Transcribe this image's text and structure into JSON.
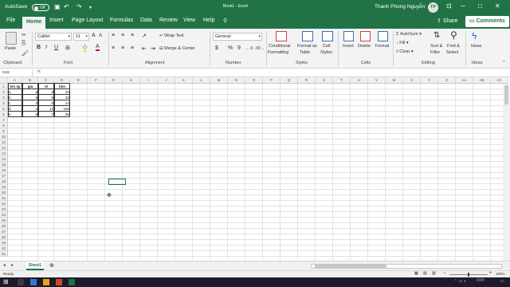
{
  "titlebar": {
    "autosave_label": "AutoSave",
    "autosave_state": "Off",
    "doc_title": "Book1 - Excel",
    "user_name": "Thanh Phong Nguyễn",
    "user_initials": "TP"
  },
  "tabs": [
    "File",
    "Home",
    "Insert",
    "Page Layout",
    "Formulas",
    "Data",
    "Review",
    "View",
    "Help"
  ],
  "active_tab": "Home",
  "share_label": "Share",
  "comments_label": "Comments",
  "ribbon": {
    "clipboard": {
      "label": "Clipboard",
      "paste": "Paste"
    },
    "font": {
      "label": "Font",
      "name": "Calibri",
      "size": "11",
      "bold": "B",
      "italic": "I",
      "underline": "U"
    },
    "alignment": {
      "label": "Alignment",
      "wrap_text": "Wrap Text",
      "merge_center": "Merge & Center"
    },
    "number": {
      "label": "Number",
      "format": "General",
      "dollar": "$",
      "percent": "%",
      "comma": "9"
    },
    "styles": {
      "label": "Styles",
      "conditional": [
        "Conditional",
        "Formatting"
      ],
      "format_table": [
        "Format as",
        "Table"
      ],
      "cell_styles": [
        "Cell",
        "Styles"
      ]
    },
    "cells": {
      "label": "Cells",
      "insert": "Insert",
      "delete": "Delete",
      "format": "Format"
    },
    "editing": {
      "label": "Editing",
      "autosum": "AutoSum",
      "fill": "Fill",
      "clear": "Clear",
      "sort_filter": [
        "Sort &",
        "Filter"
      ],
      "find_select": [
        "Find &",
        "Select"
      ]
    },
    "ideas": {
      "label": "Ideas",
      "ideas": "Ideas"
    }
  },
  "formula_bar": {
    "name_box": "G19",
    "fx": "fx",
    "content": ""
  },
  "columns": [
    "A",
    "B",
    "C",
    "D",
    "E",
    "F",
    "G",
    "H",
    "I",
    "J",
    "K",
    "L",
    "M",
    "N",
    "O",
    "P",
    "Q",
    "R",
    "S",
    "T",
    "U",
    "V",
    "W",
    "X",
    "Y",
    "Z",
    "AA",
    "AB",
    "AC"
  ],
  "rows": [
    "1",
    "2",
    "3",
    "4",
    "5",
    "6",
    "7",
    "8",
    "9",
    "10",
    "11",
    "12",
    "13",
    "14",
    "15",
    "16",
    "17",
    "18",
    "19",
    "20",
    "21",
    "22",
    "23",
    "24",
    "25",
    "26",
    "27",
    "28",
    "29",
    "30",
    "31"
  ],
  "table": {
    "headers": [
      "ten sp",
      "gia",
      "sl",
      "tien"
    ],
    "rows": [
      [
        "a",
        "5",
        "8",
        "40"
      ],
      [
        "b",
        "6",
        "5",
        "30"
      ],
      [
        "c",
        "4",
        "6",
        "24"
      ],
      [
        "d",
        "4",
        "12",
        "156"
      ],
      [
        "e",
        "8",
        "7",
        "56"
      ]
    ]
  },
  "sheet_tab": "Sheet1",
  "status": {
    "ready": "Ready",
    "zoom": "100%"
  },
  "colors": {
    "excel_green": "#217346",
    "ribbon_bg": "#f3f3f3",
    "grid_line": "#e2e2e2"
  }
}
